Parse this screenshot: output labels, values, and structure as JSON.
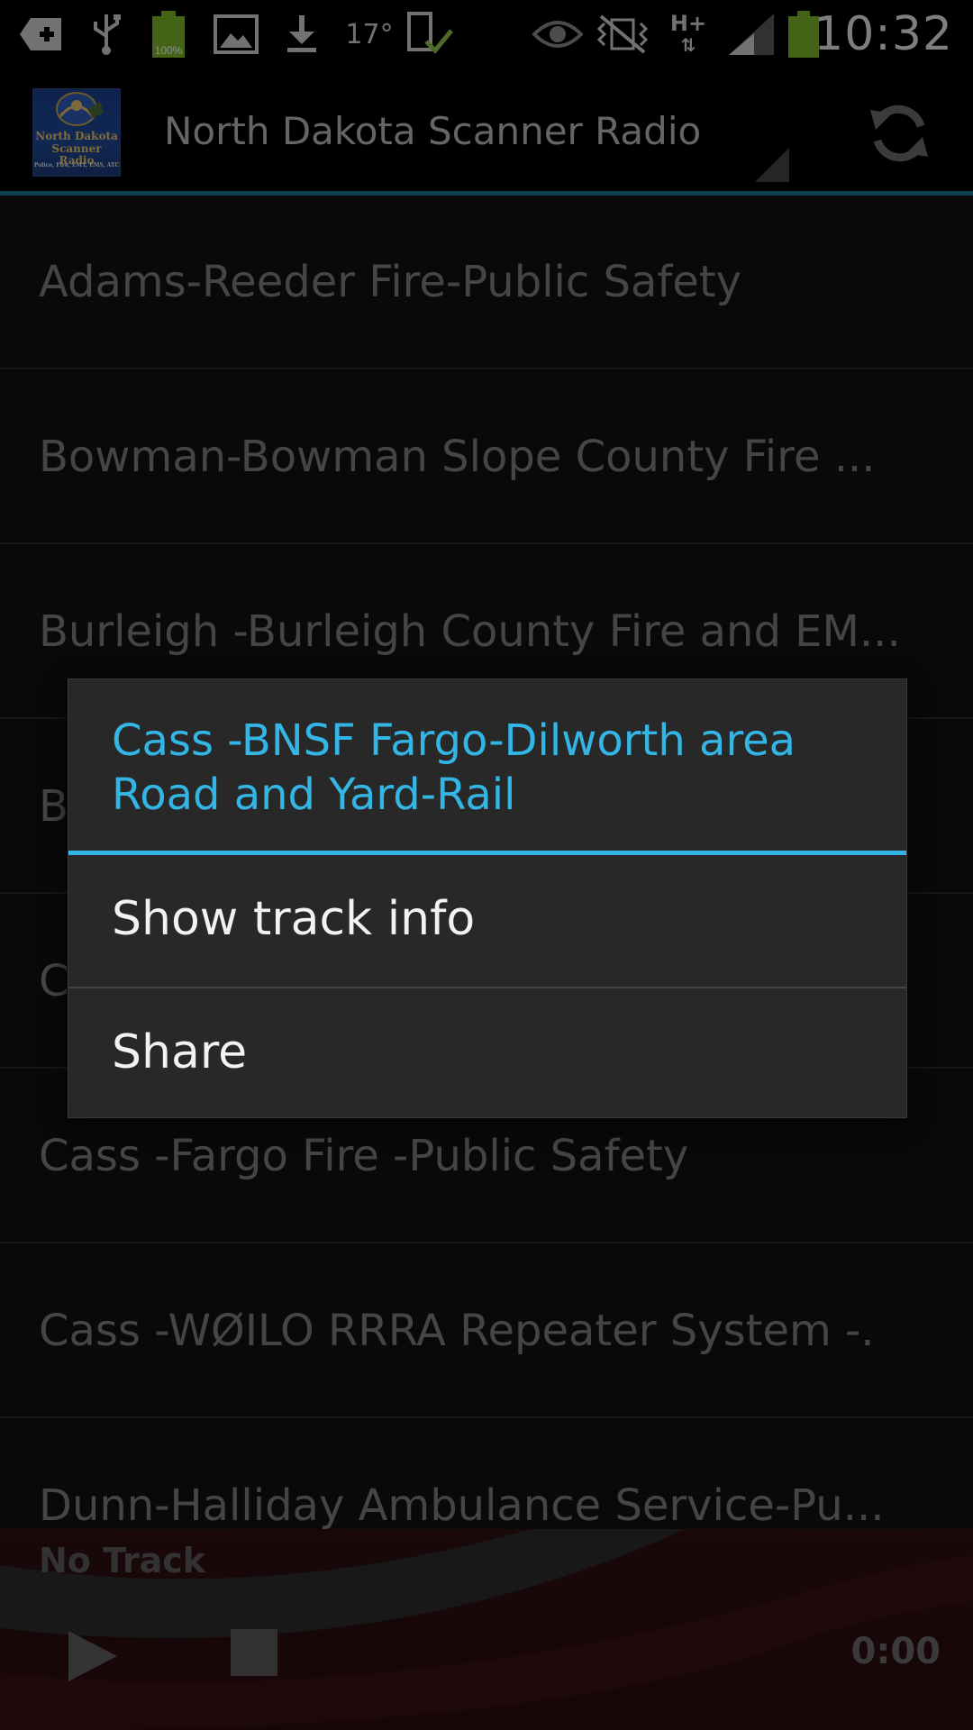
{
  "status_bar": {
    "battery_percent": "100%",
    "temperature": "17°",
    "network_type": "H+",
    "clock": "10:32",
    "icons": [
      "add-notification-icon",
      "usb-icon",
      "battery-full-icon",
      "image-icon",
      "download-icon",
      "temperature-icon",
      "device-check-icon",
      "eye-icon",
      "muted-vibrate-icon",
      "hplus-data-icon",
      "signal-icon",
      "battery-icon"
    ]
  },
  "app_bar": {
    "logo_text_lines": [
      "North Dakota",
      "Scanner Radio",
      "Police, Fire, EMT, EMS, ATC"
    ],
    "title": "North Dakota Scanner Radio",
    "refresh_icon": "refresh-icon",
    "accent_color": "#1d6f95"
  },
  "station_list": {
    "items": [
      {
        "label": "Adams-Reeder Fire-Public Safety"
      },
      {
        "label": "Bowman-Bowman Slope County Fire ..."
      },
      {
        "label": "Burleigh -Burleigh County Fire and EM..."
      },
      {
        "label": "B"
      },
      {
        "label": "C"
      },
      {
        "label": "Cass -Fargo Fire -Public Safety"
      },
      {
        "label": "Cass -WØILO RRRA Repeater System -."
      },
      {
        "label": "Dunn-Halliday Ambulance Service-Pu..."
      }
    ]
  },
  "player": {
    "track": "No Track",
    "time": "0:00",
    "play_icon": "play-icon",
    "stop_icon": "stop-icon"
  },
  "context_dialog": {
    "title": "Cass -BNSF Fargo-Dilworth area Road and Yard-Rail",
    "title_color": "#33b5e5",
    "items": [
      {
        "label": "Show track info"
      },
      {
        "label": "Share"
      }
    ]
  }
}
